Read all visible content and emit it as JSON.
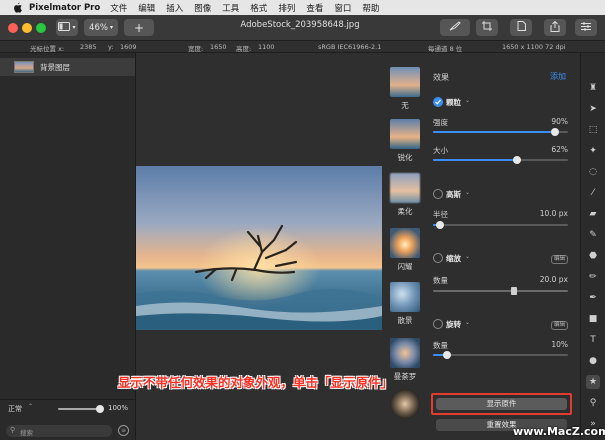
{
  "menubar": {
    "app": "Pixelmator Pro",
    "items": [
      "文件",
      "编辑",
      "插入",
      "图像",
      "工具",
      "格式",
      "排列",
      "查看",
      "窗口",
      "帮助"
    ]
  },
  "toolbar": {
    "zoom": "46%",
    "add": "+",
    "doc_title": "AdobeStock_203958648.jpg"
  },
  "infobar": {
    "cursor_label": "光标位置 x:",
    "cursor_x": "2385",
    "y_label": "y:",
    "cursor_y": "1609",
    "width_label": "宽度:",
    "width": "1650",
    "height_label": "高度:",
    "height": "1100",
    "color_profile": "sRGB IEC61966-2.1",
    "channel": "每通道 8 位",
    "dims": "1650 x 1100 72 dpi"
  },
  "layers": {
    "items": [
      {
        "name": "背景图层"
      }
    ],
    "blend_mode": "正常",
    "opacity": "100%",
    "opacity_value": 1.0,
    "search_placeholder": "搜索"
  },
  "effects_list": {
    "items": [
      {
        "label": "无"
      },
      {
        "label": "锐化"
      },
      {
        "label": "柔化"
      },
      {
        "label": "闪耀"
      },
      {
        "label": "散景"
      },
      {
        "label": "曼荼罗"
      }
    ]
  },
  "props": {
    "header": "效果",
    "add": "添加",
    "grain": {
      "title": "颗粒",
      "strength_label": "强度",
      "strength": "90%",
      "strength_value": 0.9,
      "size_label": "大小",
      "size": "62%",
      "size_value": 0.62
    },
    "noise": {
      "title": "高斯",
      "radius_label": "半径",
      "radius": "10.0 px",
      "radius_value": 0.05
    },
    "zoom": {
      "title": "缩放",
      "amount_label": "数量",
      "amount": "20.0 px",
      "amount_value": 0.6,
      "badge": "编辑"
    },
    "spin": {
      "title": "旋转",
      "amount_label": "数量",
      "amount": "10%",
      "amount_value": 0.1,
      "badge": "编辑"
    },
    "show_original": "显示原件",
    "reset": "重置效果"
  },
  "annotation": {
    "text": "显示不带任何效果的对象外观，单击「显示原件」"
  },
  "watermark": "www.MacZ.com",
  "colors": {
    "accent": "#3a8ff5",
    "annotation": "#ff2d20",
    "annotation_box": "#e53a2f"
  }
}
